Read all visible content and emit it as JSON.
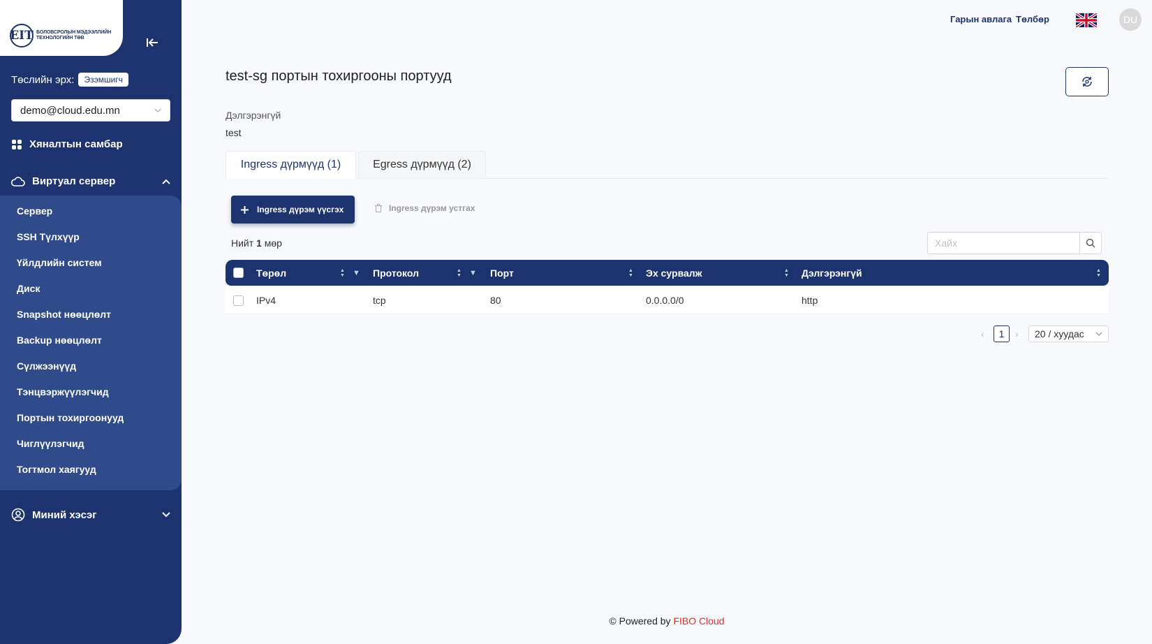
{
  "sidebar": {
    "logo_mark": "EIT",
    "logo_text": "БОЛОВСРОЛЫН МЭДЭЭЛЛИЙН ТЕХНОЛОГИЙН ТӨВ",
    "role_label": "Төслийн эрх:",
    "role_value": "Эзэмшигч",
    "account": "demo@cloud.edu.mn",
    "dashboard": "Хяналтын самбар",
    "virtual_server": "Виртуал сервер",
    "sub_items": [
      "Сервер",
      "SSH Түлхүүр",
      "Үйлдлийн систем",
      "Диск",
      "Snapshot нөөцлөлт",
      "Backup нөөцлөлт",
      "Сүлжээнүүд",
      "Тэнцвэржүүлэгчид",
      "Портын тохиргоонууд",
      "Чиглүүлэгчид",
      "Тогтмол хаягууд"
    ],
    "my_section": "Миний хэсэг"
  },
  "header": {
    "guide": "Гарын авлага",
    "payment": "Төлбөр",
    "avatar": "DU"
  },
  "page": {
    "title": "test-sg портын тохиргооны портууд",
    "desc_label": "Дэлгэрэнгүй",
    "desc_value": "test"
  },
  "tabs": [
    {
      "label": "Ingress дүрмүүд (1)",
      "active": true
    },
    {
      "label": "Egress дүрмүүд (2)",
      "active": false
    }
  ],
  "actions": {
    "create": "Ingress дүрэм үүсгэх",
    "delete": "Ingress дүрэм устгах"
  },
  "total": {
    "prefix": "Нийт",
    "count": "1",
    "suffix": "мөр"
  },
  "search": {
    "placeholder": "Хайх"
  },
  "table": {
    "columns": [
      "Төрөл",
      "Протокол",
      "Порт",
      "Эх сурвалж",
      "Дэлгэрэнгүй"
    ],
    "rows": [
      [
        "IPv4",
        "tcp",
        "80",
        "0.0.0.0/0",
        "http"
      ]
    ]
  },
  "pagination": {
    "current": "1",
    "page_size": "20 / хуудас"
  },
  "footer": {
    "prefix": "© Powered by",
    "brand": "FIBO Cloud"
  }
}
